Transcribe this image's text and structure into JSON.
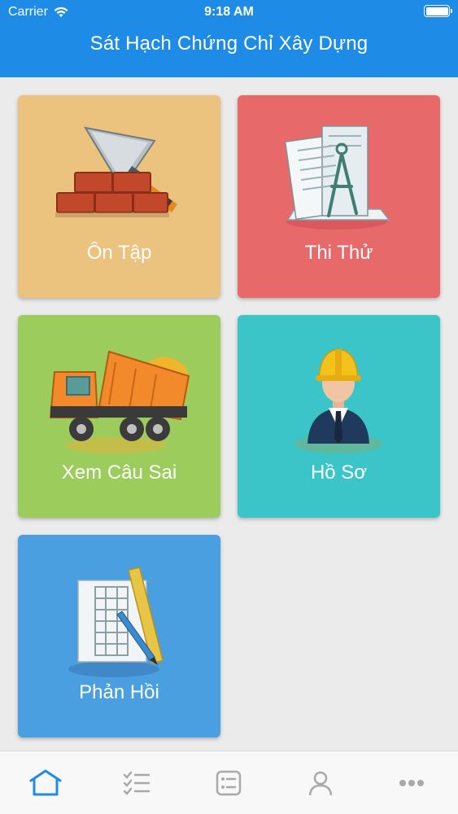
{
  "status_bar": {
    "carrier": "Carrier",
    "time": "9:18 AM"
  },
  "header": {
    "title": "Sát Hạch Chứng Chỉ Xây Dựng"
  },
  "colors": {
    "header": "#1e8be6",
    "tile_on_tap": "#ebc27e",
    "tile_thi_thu": "#e7696a",
    "tile_xem_cau_sai": "#9ccc5c",
    "tile_ho_so": "#3cc5c8",
    "tile_phan_hoi": "#4a9fe0",
    "tab_active": "#1e8be6",
    "tab_inactive": "#a9a9a9"
  },
  "tiles": [
    {
      "label": "Ôn Tập",
      "icon": "brick-trowel-icon"
    },
    {
      "label": "Thi Thử",
      "icon": "blueprint-compass-icon"
    },
    {
      "label": "Xem Câu Sai",
      "icon": "dump-truck-icon"
    },
    {
      "label": "Hồ Sơ",
      "icon": "engineer-icon"
    },
    {
      "label": "Phản Hồi",
      "icon": "building-ruler-icon"
    }
  ],
  "tabbar": {
    "tabs": [
      {
        "icon": "home-icon",
        "active": true
      },
      {
        "icon": "checklist-icon",
        "active": false
      },
      {
        "icon": "list-card-icon",
        "active": false
      },
      {
        "icon": "user-icon",
        "active": false
      },
      {
        "icon": "more-icon",
        "active": false
      }
    ]
  }
}
